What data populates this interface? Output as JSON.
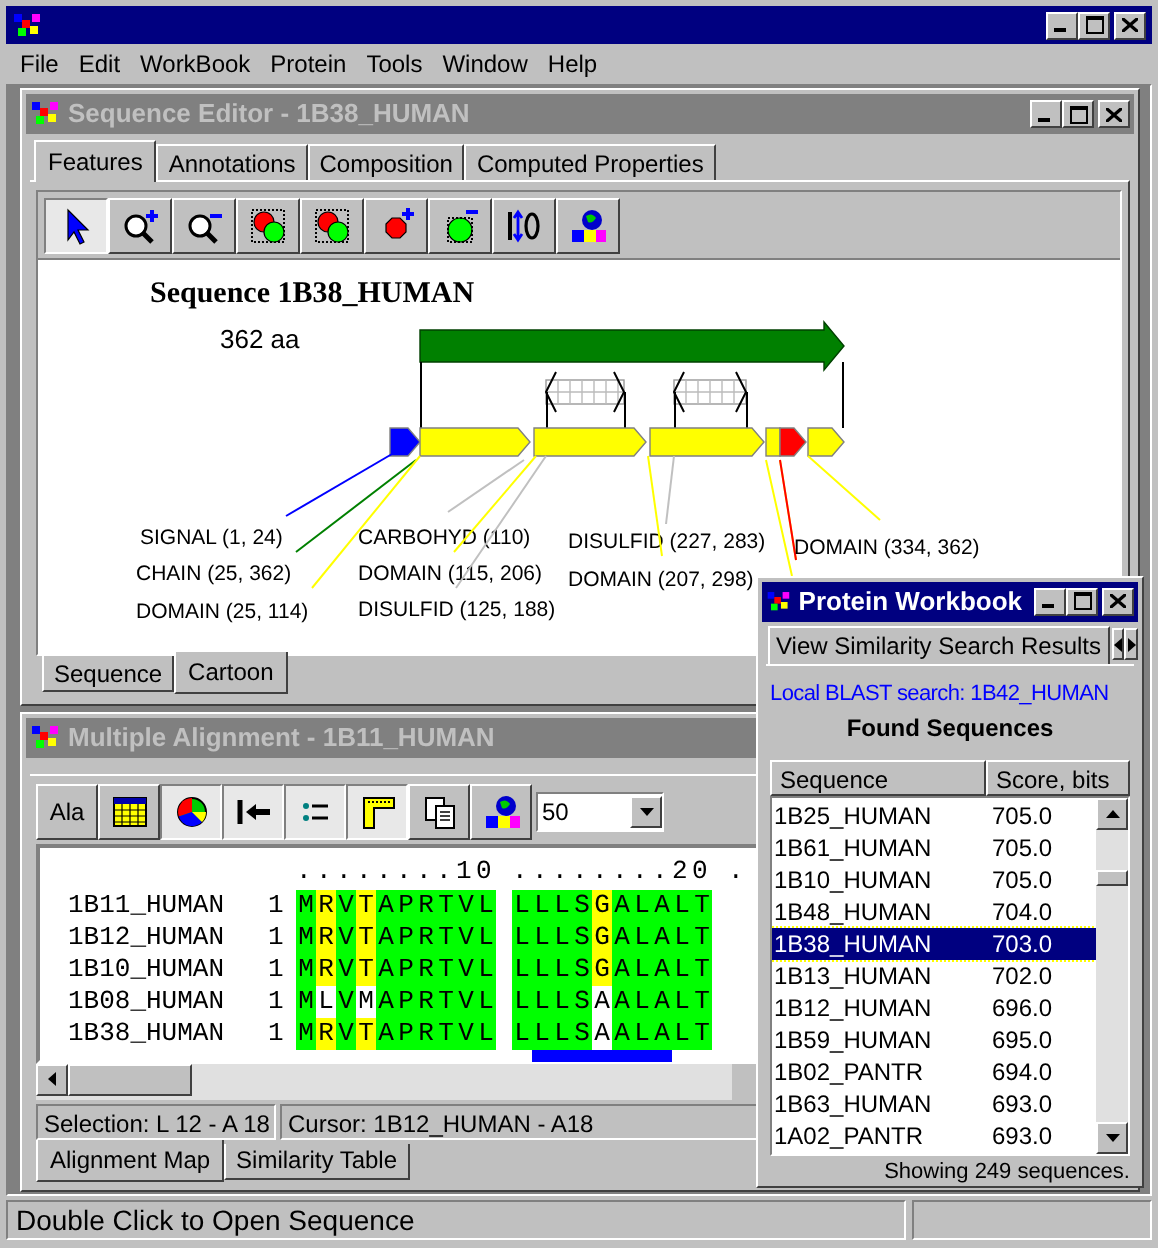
{
  "app": {
    "menu": [
      "File",
      "Edit",
      "WorkBook",
      "Protein",
      "Tools",
      "Window",
      "Help"
    ]
  },
  "sequence_editor": {
    "title": "Sequence Editor - 1B38_HUMAN",
    "active": false,
    "tabs": [
      {
        "label": "Features",
        "selected": true
      },
      {
        "label": "Annotations",
        "selected": false
      },
      {
        "label": "Composition",
        "selected": false
      },
      {
        "label": "Computed Properties",
        "selected": false
      }
    ],
    "toolbar": [
      {
        "kind": "pointer",
        "pressed": true
      },
      {
        "kind": "zoom-in",
        "pressed": false
      },
      {
        "kind": "zoom-out",
        "pressed": false
      },
      {
        "kind": "cluster",
        "pressed": false
      },
      {
        "kind": "cluster",
        "pressed": false
      },
      {
        "kind": "add",
        "pressed": false
      },
      {
        "kind": "remove",
        "pressed": false
      },
      {
        "kind": "swap",
        "pressed": false
      },
      {
        "kind": "globe",
        "pressed": false
      }
    ],
    "sequence_title": "Sequence 1B38_HUMAN",
    "length": "362 aa",
    "features": [
      {
        "label": "SIGNAL (1, 24)",
        "color": "#0000ff"
      },
      {
        "label": "CHAIN (25, 362)",
        "color": "#008000"
      },
      {
        "label": "DOMAIN (25, 114)",
        "color": "#ffff00"
      },
      {
        "label": "CARBOHYD (110)",
        "color": "#c0c0c0"
      },
      {
        "label": "DOMAIN (115, 206)",
        "color": "#ffff00"
      },
      {
        "label": "DISULFID (125, 188)",
        "color": "#c0c0c0"
      },
      {
        "label": "DISULFID (227, 283)",
        "color": "#c0c0c0"
      },
      {
        "label": "DOMAIN (207, 298)",
        "color": "#ffff00"
      },
      {
        "label": "DOMAIN (334, 362)",
        "color": "#ffff00"
      }
    ],
    "view_tabs": [
      {
        "label": "Sequence",
        "selected": false
      },
      {
        "label": "Cartoon",
        "selected": true
      }
    ]
  },
  "alignment": {
    "title": "Multiple Alignment - 1B11_HUMAN",
    "active": false,
    "toolbar": [
      {
        "kind": "text",
        "label": "Ala",
        "pressed": false
      },
      {
        "kind": "table",
        "pressed": false
      },
      {
        "kind": "pie",
        "pressed": true
      },
      {
        "kind": "arrow-bar",
        "pressed": true
      },
      {
        "kind": "list",
        "pressed": true
      },
      {
        "kind": "corner",
        "pressed": true
      },
      {
        "kind": "copy",
        "pressed": false
      },
      {
        "kind": "globe",
        "pressed": false
      }
    ],
    "width_value": "50",
    "ruler": [
      "........10",
      "........20",
      "."
    ],
    "rows": [
      {
        "name": "1B11_HUMAN",
        "start": "1",
        "residues": [
          {
            "aa": "M",
            "color": "#00ff00"
          },
          {
            "aa": "R",
            "color": "#ffff00"
          },
          {
            "aa": "V",
            "color": "#00ff00"
          },
          {
            "aa": "T",
            "color": "#ffff00"
          },
          {
            "aa": "A",
            "color": "#00ff00"
          },
          {
            "aa": "P",
            "color": "#00ff00"
          },
          {
            "aa": "R",
            "color": "#00ff00"
          },
          {
            "aa": "T",
            "color": "#00ff00"
          },
          {
            "aa": "V",
            "color": "#00ff00"
          },
          {
            "aa": "L",
            "color": "#00ff00"
          },
          {
            "aa": "L",
            "color": "#00ff00"
          },
          {
            "aa": "L",
            "color": "#00ff00"
          },
          {
            "aa": "L",
            "color": "#00ff00"
          },
          {
            "aa": "S",
            "color": "#00ff00"
          },
          {
            "aa": "G",
            "color": "#ffff00"
          },
          {
            "aa": "A",
            "color": "#00ff00"
          },
          {
            "aa": "L",
            "color": "#00ff00"
          },
          {
            "aa": "A",
            "color": "#00ff00"
          },
          {
            "aa": "L",
            "color": "#00ff00"
          },
          {
            "aa": "T",
            "color": "#00ff00"
          }
        ]
      },
      {
        "name": "1B12_HUMAN",
        "start": "1",
        "residues": [
          {
            "aa": "M",
            "color": "#00ff00"
          },
          {
            "aa": "R",
            "color": "#ffff00"
          },
          {
            "aa": "V",
            "color": "#00ff00"
          },
          {
            "aa": "T",
            "color": "#ffff00"
          },
          {
            "aa": "A",
            "color": "#00ff00"
          },
          {
            "aa": "P",
            "color": "#00ff00"
          },
          {
            "aa": "R",
            "color": "#00ff00"
          },
          {
            "aa": "T",
            "color": "#00ff00"
          },
          {
            "aa": "V",
            "color": "#00ff00"
          },
          {
            "aa": "L",
            "color": "#00ff00"
          },
          {
            "aa": "L",
            "color": "#00ff00"
          },
          {
            "aa": "L",
            "color": "#00ff00"
          },
          {
            "aa": "L",
            "color": "#00ff00"
          },
          {
            "aa": "S",
            "color": "#00ff00"
          },
          {
            "aa": "G",
            "color": "#ffff00"
          },
          {
            "aa": "A",
            "color": "#00ff00"
          },
          {
            "aa": "L",
            "color": "#00ff00"
          },
          {
            "aa": "A",
            "color": "#00ff00"
          },
          {
            "aa": "L",
            "color": "#00ff00"
          },
          {
            "aa": "T",
            "color": "#00ff00"
          }
        ]
      },
      {
        "name": "1B10_HUMAN",
        "start": "1",
        "residues": [
          {
            "aa": "M",
            "color": "#00ff00"
          },
          {
            "aa": "R",
            "color": "#ffff00"
          },
          {
            "aa": "V",
            "color": "#00ff00"
          },
          {
            "aa": "T",
            "color": "#ffff00"
          },
          {
            "aa": "A",
            "color": "#00ff00"
          },
          {
            "aa": "P",
            "color": "#00ff00"
          },
          {
            "aa": "R",
            "color": "#00ff00"
          },
          {
            "aa": "T",
            "color": "#00ff00"
          },
          {
            "aa": "V",
            "color": "#00ff00"
          },
          {
            "aa": "L",
            "color": "#00ff00"
          },
          {
            "aa": "L",
            "color": "#00ff00"
          },
          {
            "aa": "L",
            "color": "#00ff00"
          },
          {
            "aa": "L",
            "color": "#00ff00"
          },
          {
            "aa": "S",
            "color": "#00ff00"
          },
          {
            "aa": "G",
            "color": "#ffff00"
          },
          {
            "aa": "A",
            "color": "#00ff00"
          },
          {
            "aa": "L",
            "color": "#00ff00"
          },
          {
            "aa": "A",
            "color": "#00ff00"
          },
          {
            "aa": "L",
            "color": "#00ff00"
          },
          {
            "aa": "T",
            "color": "#00ff00"
          }
        ]
      },
      {
        "name": "1B08_HUMAN",
        "start": "1",
        "residues": [
          {
            "aa": "M",
            "color": "#00ff00"
          },
          {
            "aa": "L",
            "color": "#ffffff"
          },
          {
            "aa": "V",
            "color": "#00ff00"
          },
          {
            "aa": "M",
            "color": "#ffffff"
          },
          {
            "aa": "A",
            "color": "#00ff00"
          },
          {
            "aa": "P",
            "color": "#00ff00"
          },
          {
            "aa": "R",
            "color": "#00ff00"
          },
          {
            "aa": "T",
            "color": "#00ff00"
          },
          {
            "aa": "V",
            "color": "#00ff00"
          },
          {
            "aa": "L",
            "color": "#00ff00"
          },
          {
            "aa": "L",
            "color": "#00ff00"
          },
          {
            "aa": "L",
            "color": "#00ff00"
          },
          {
            "aa": "L",
            "color": "#00ff00"
          },
          {
            "aa": "S",
            "color": "#00ff00"
          },
          {
            "aa": "A",
            "color": "#ffffff"
          },
          {
            "aa": "A",
            "color": "#00ff00"
          },
          {
            "aa": "L",
            "color": "#00ff00"
          },
          {
            "aa": "A",
            "color": "#00ff00"
          },
          {
            "aa": "L",
            "color": "#00ff00"
          },
          {
            "aa": "T",
            "color": "#00ff00"
          }
        ]
      },
      {
        "name": "1B38_HUMAN",
        "start": "1",
        "residues": [
          {
            "aa": "M",
            "color": "#00ff00"
          },
          {
            "aa": "R",
            "color": "#ffff00"
          },
          {
            "aa": "V",
            "color": "#00ff00"
          },
          {
            "aa": "T",
            "color": "#ffff00"
          },
          {
            "aa": "A",
            "color": "#00ff00"
          },
          {
            "aa": "P",
            "color": "#00ff00"
          },
          {
            "aa": "R",
            "color": "#00ff00"
          },
          {
            "aa": "T",
            "color": "#00ff00"
          },
          {
            "aa": "V",
            "color": "#00ff00"
          },
          {
            "aa": "L",
            "color": "#00ff00"
          },
          {
            "aa": "L",
            "color": "#00ff00"
          },
          {
            "aa": "L",
            "color": "#00ff00"
          },
          {
            "aa": "L",
            "color": "#00ff00"
          },
          {
            "aa": "S",
            "color": "#00ff00"
          },
          {
            "aa": "A",
            "color": "#ffffff"
          },
          {
            "aa": "A",
            "color": "#00ff00"
          },
          {
            "aa": "L",
            "color": "#00ff00"
          },
          {
            "aa": "A",
            "color": "#00ff00"
          },
          {
            "aa": "L",
            "color": "#00ff00"
          },
          {
            "aa": "T",
            "color": "#00ff00"
          }
        ]
      }
    ],
    "selection_bar": [
      false,
      false,
      false,
      false,
      false,
      false,
      false,
      false,
      false,
      false,
      false,
      true,
      true,
      true,
      true,
      true,
      true,
      true,
      false,
      false
    ],
    "selection": "Selection: L 12 - A 18",
    "cursor": "Cursor: 1B12_HUMAN - A18",
    "tabs": [
      {
        "label": "Alignment Map",
        "selected": true
      },
      {
        "label": "Similarity Table",
        "selected": false
      }
    ]
  },
  "workbook": {
    "title": "Protein Workbook",
    "active": true,
    "tab": "View Similarity Search Results",
    "search_label": "Local BLAST search: 1B42_HUMAN",
    "heading": "Found Sequences",
    "columns": [
      "Sequence",
      "Score, bits"
    ],
    "rows": [
      {
        "sequence": "1B25_HUMAN",
        "score": "705.0",
        "selected": false
      },
      {
        "sequence": "1B61_HUMAN",
        "score": "705.0",
        "selected": false
      },
      {
        "sequence": "1B10_HUMAN",
        "score": "705.0",
        "selected": false
      },
      {
        "sequence": "1B48_HUMAN",
        "score": "704.0",
        "selected": false
      },
      {
        "sequence": "1B38_HUMAN",
        "score": "703.0",
        "selected": true
      },
      {
        "sequence": "1B13_HUMAN",
        "score": "702.0",
        "selected": false
      },
      {
        "sequence": "1B12_HUMAN",
        "score": "696.0",
        "selected": false
      },
      {
        "sequence": "1B59_HUMAN",
        "score": "695.0",
        "selected": false
      },
      {
        "sequence": "1B02_PANTR",
        "score": "694.0",
        "selected": false
      },
      {
        "sequence": "1B63_HUMAN",
        "score": "693.0",
        "selected": false
      },
      {
        "sequence": "1A02_PANTR",
        "score": "693.0",
        "selected": false
      }
    ],
    "footer": "Showing 249 sequences."
  },
  "status_bar": "Double Click to Open Sequence"
}
